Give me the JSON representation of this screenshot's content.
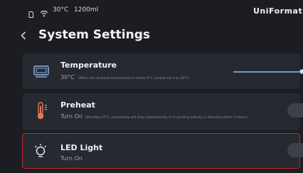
{
  "status_bar": {
    "temperature": "30°C",
    "volume": "1200ml",
    "brand": "UniFormation",
    "icons": [
      "sd-card-icon",
      "wifi-icon"
    ]
  },
  "header": {
    "title": "System Settings",
    "back_icon": "chevron-left-icon"
  },
  "settings": {
    "temperature": {
      "label": "Temperature",
      "value": "30°C",
      "note": "(When the ambient temperature is below 5°C, please set it to 30°C)",
      "slider_level": 0.88,
      "icon": "heater-icon"
    },
    "preheat": {
      "label": "Preheat",
      "value": "Turn On",
      "note": "(Maintain 25°C, preheating will stop automatically if no printing activity is detected within 3 hours.)",
      "enabled": true,
      "icon": "thermometer-icon"
    },
    "led_light": {
      "label": "LED Light",
      "value": "Turn On",
      "enabled": true,
      "icon": "light-bulb-icon"
    }
  },
  "colors": {
    "background": "#1b1d22",
    "card": "#262930",
    "accent": "#2f7de6",
    "highlight_border": "#c8262d"
  }
}
